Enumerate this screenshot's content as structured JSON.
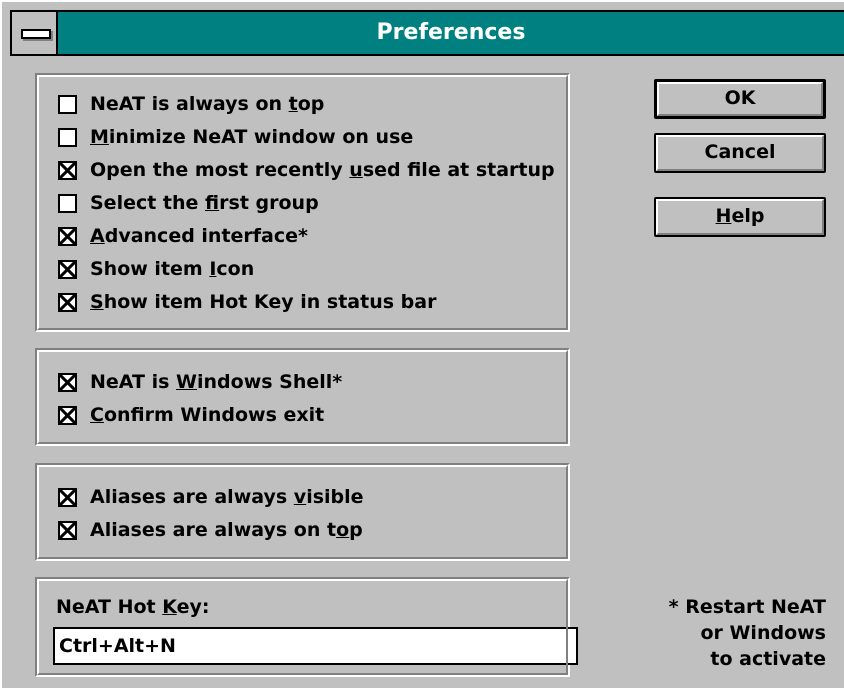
{
  "window": {
    "title": "Preferences"
  },
  "options_group1": [
    {
      "pre": "NeAT is always on ",
      "key": "t",
      "post": "op",
      "checked": false
    },
    {
      "pre": "",
      "key": "M",
      "post": "inimize NeAT window on use",
      "checked": false
    },
    {
      "pre": "Open the most recently ",
      "key": "u",
      "post": "sed file at startup",
      "checked": true
    },
    {
      "pre": "Select the ",
      "key": "f",
      "post": "irst group",
      "checked": false
    },
    {
      "pre": "",
      "key": "A",
      "post": "dvanced interface*",
      "checked": true
    },
    {
      "pre": "Show item ",
      "key": "I",
      "post": "con",
      "checked": true
    },
    {
      "pre": "",
      "key": "S",
      "post": "how item Hot Key in status bar",
      "checked": true
    }
  ],
  "options_group2": [
    {
      "pre": "NeAT is ",
      "key": "W",
      "post": "indows Shell*",
      "checked": true
    },
    {
      "pre": "",
      "key": "C",
      "post": "onfirm Windows exit",
      "checked": true
    }
  ],
  "options_group3": [
    {
      "pre": "Aliases are always ",
      "key": "v",
      "post": "isible",
      "checked": true
    },
    {
      "pre": "Aliases are always on t",
      "key": "o",
      "post": "p",
      "checked": true
    }
  ],
  "buttons": {
    "ok": "OK",
    "cancel": "Cancel",
    "help_key": "H",
    "help_rest": "elp"
  },
  "hotkey": {
    "label_pre": "NeAT Hot ",
    "label_key": "K",
    "label_post": "ey:",
    "value": "Ctrl+Alt+N"
  },
  "note": "* Restart NeAT\nor Windows\nto activate"
}
